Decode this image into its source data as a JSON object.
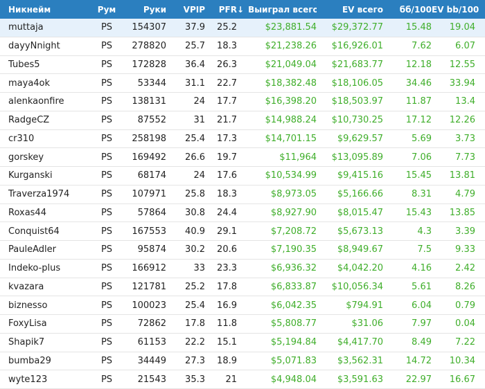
{
  "header": {
    "nickname": "Никнейм",
    "room": "Рум",
    "hands": "Руки",
    "vpip": "VPIP",
    "pfr": "PFR",
    "sort_icon": "↓",
    "won_total": "Выиграл всего",
    "ev_total": "EV всего",
    "bb100": "бб/100",
    "ev_bb100": "EV bb/100"
  },
  "colors": {
    "header_bg": "#2b7fbf",
    "money": "#3fae2a",
    "selected_row": "#e6f1fb"
  },
  "rows": [
    {
      "name": "muttaja",
      "room": "PS",
      "hands": "154307",
      "vpip": "37.9",
      "pfr": "25.2",
      "won": "$23,881.54",
      "ev": "$29,372.77",
      "bb": "15.48",
      "evbb": "19.04"
    },
    {
      "name": "dayyNnight",
      "room": "PS",
      "hands": "278820",
      "vpip": "25.7",
      "pfr": "18.3",
      "won": "$21,238.26",
      "ev": "$16,926.01",
      "bb": "7.62",
      "evbb": "6.07"
    },
    {
      "name": "Tubes5",
      "room": "PS",
      "hands": "172828",
      "vpip": "36.4",
      "pfr": "26.3",
      "won": "$21,049.04",
      "ev": "$21,683.77",
      "bb": "12.18",
      "evbb": "12.55"
    },
    {
      "name": "maya4ok",
      "room": "PS",
      "hands": "53344",
      "vpip": "31.1",
      "pfr": "22.7",
      "won": "$18,382.48",
      "ev": "$18,106.05",
      "bb": "34.46",
      "evbb": "33.94"
    },
    {
      "name": "alenkaonfire",
      "room": "PS",
      "hands": "138131",
      "vpip": "24",
      "pfr": "17.7",
      "won": "$16,398.20",
      "ev": "$18,503.97",
      "bb": "11.87",
      "evbb": "13.4"
    },
    {
      "name": "RadgeCZ",
      "room": "PS",
      "hands": "87552",
      "vpip": "31",
      "pfr": "21.7",
      "won": "$14,988.24",
      "ev": "$10,730.25",
      "bb": "17.12",
      "evbb": "12.26"
    },
    {
      "name": "cr310",
      "room": "PS",
      "hands": "258198",
      "vpip": "25.4",
      "pfr": "17.3",
      "won": "$14,701.15",
      "ev": "$9,629.57",
      "bb": "5.69",
      "evbb": "3.73"
    },
    {
      "name": "gorskey",
      "room": "PS",
      "hands": "169492",
      "vpip": "26.6",
      "pfr": "19.7",
      "won": "$11,964",
      "ev": "$13,095.89",
      "bb": "7.06",
      "evbb": "7.73"
    },
    {
      "name": "Kurganski",
      "room": "PS",
      "hands": "68174",
      "vpip": "24",
      "pfr": "17.6",
      "won": "$10,534.99",
      "ev": "$9,415.16",
      "bb": "15.45",
      "evbb": "13.81"
    },
    {
      "name": "Traverza1974",
      "room": "PS",
      "hands": "107971",
      "vpip": "25.8",
      "pfr": "18.3",
      "won": "$8,973.05",
      "ev": "$5,166.66",
      "bb": "8.31",
      "evbb": "4.79"
    },
    {
      "name": "Roxas44",
      "room": "PS",
      "hands": "57864",
      "vpip": "30.8",
      "pfr": "24.4",
      "won": "$8,927.90",
      "ev": "$8,015.47",
      "bb": "15.43",
      "evbb": "13.85"
    },
    {
      "name": "Conquist64",
      "room": "PS",
      "hands": "167553",
      "vpip": "40.9",
      "pfr": "29.1",
      "won": "$7,208.72",
      "ev": "$5,673.13",
      "bb": "4.3",
      "evbb": "3.39"
    },
    {
      "name": "PauleAdler",
      "room": "PS",
      "hands": "95874",
      "vpip": "30.2",
      "pfr": "20.6",
      "won": "$7,190.35",
      "ev": "$8,949.67",
      "bb": "7.5",
      "evbb": "9.33"
    },
    {
      "name": "Indeko-plus",
      "room": "PS",
      "hands": "166912",
      "vpip": "33",
      "pfr": "23.3",
      "won": "$6,936.32",
      "ev": "$4,042.20",
      "bb": "4.16",
      "evbb": "2.42"
    },
    {
      "name": "kvazara",
      "room": "PS",
      "hands": "121781",
      "vpip": "25.2",
      "pfr": "17.8",
      "won": "$6,833.87",
      "ev": "$10,056.34",
      "bb": "5.61",
      "evbb": "8.26"
    },
    {
      "name": "biznesso",
      "room": "PS",
      "hands": "100023",
      "vpip": "25.4",
      "pfr": "16.9",
      "won": "$6,042.35",
      "ev": "$794.91",
      "bb": "6.04",
      "evbb": "0.79"
    },
    {
      "name": "FoxyLisa",
      "room": "PS",
      "hands": "72862",
      "vpip": "17.8",
      "pfr": "11.8",
      "won": "$5,808.77",
      "ev": "$31.06",
      "bb": "7.97",
      "evbb": "0.04"
    },
    {
      "name": "Shapik7",
      "room": "PS",
      "hands": "61153",
      "vpip": "22.2",
      "pfr": "15.1",
      "won": "$5,194.84",
      "ev": "$4,417.70",
      "bb": "8.49",
      "evbb": "7.22"
    },
    {
      "name": "bumba29",
      "room": "PS",
      "hands": "34449",
      "vpip": "27.3",
      "pfr": "18.9",
      "won": "$5,071.83",
      "ev": "$3,562.31",
      "bb": "14.72",
      "evbb": "10.34"
    },
    {
      "name": "wyte123",
      "room": "PS",
      "hands": "21543",
      "vpip": "35.3",
      "pfr": "21",
      "won": "$4,948.04",
      "ev": "$3,591.63",
      "bb": "22.97",
      "evbb": "16.67"
    }
  ]
}
